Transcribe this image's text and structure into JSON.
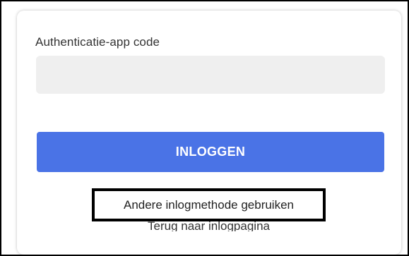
{
  "form": {
    "code_label": "Authenticatie-app code",
    "code_value": "",
    "code_placeholder": "",
    "login_button_label": "INLOGGEN",
    "other_method_link": "Andere inlogmethode gebruiken",
    "back_link": "Terug naar inlogpagina"
  },
  "colors": {
    "primary_button": "#4a73e6",
    "input_background": "#efefef",
    "highlight_border": "#000000"
  }
}
